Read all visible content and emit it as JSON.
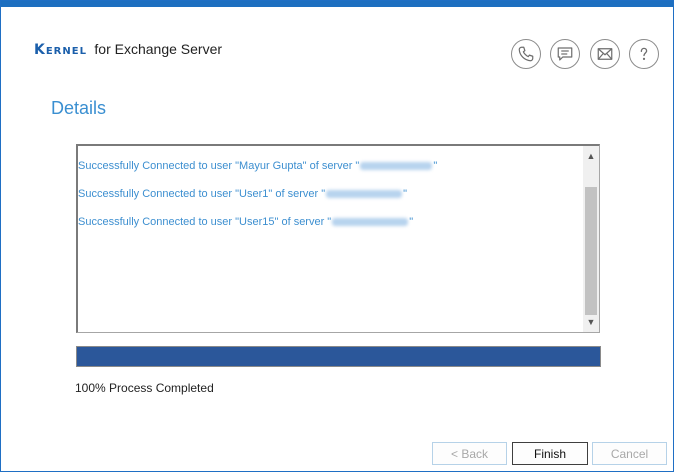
{
  "brand": {
    "logo_text": "Kernel",
    "product_name": "for Exchange Server"
  },
  "header_icons": [
    {
      "name": "phone-icon"
    },
    {
      "name": "chat-icon"
    },
    {
      "name": "mail-icon"
    },
    {
      "name": "help-icon"
    }
  ],
  "section": {
    "title": "Details"
  },
  "log": {
    "lines": [
      {
        "prefix": "Successfully Connected to user \"Mayur Gupta\" of server \"",
        "suffix": "\""
      },
      {
        "prefix": "Successfully Connected to user \"User1\" of server \"",
        "suffix": "\""
      },
      {
        "prefix": "Successfully Connected to user \"User15\" of server \"",
        "suffix": "\""
      }
    ]
  },
  "progress": {
    "percent": 100,
    "status_text": "100% Process Completed"
  },
  "buttons": {
    "back": "< Back",
    "finish": "Finish",
    "cancel": "Cancel"
  },
  "colors": {
    "accent": "#1d6fc0",
    "title": "#3a8fd1",
    "progress": "#2b579a"
  }
}
